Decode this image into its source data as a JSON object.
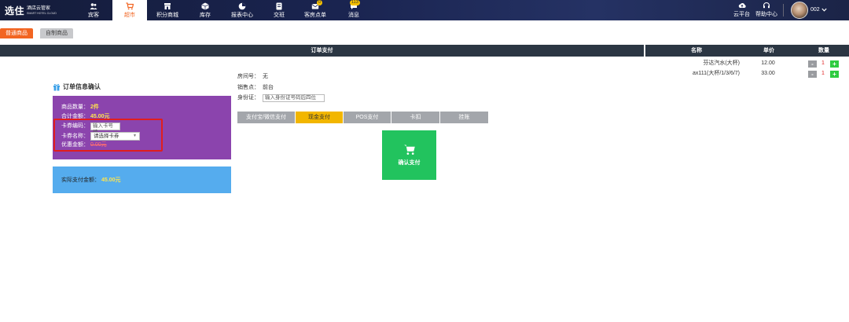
{
  "brand": {
    "logo_main": "选住",
    "logo_sub": "酒店云管家",
    "logo_tiny": "SMART HOTEL CLOUD"
  },
  "nav": [
    {
      "label": "宾客",
      "icon": "users-icon"
    },
    {
      "label": "超市",
      "icon": "cart-icon",
      "active": true
    },
    {
      "label": "积分商城",
      "icon": "store-icon"
    },
    {
      "label": "库存",
      "icon": "box-icon"
    },
    {
      "label": "报表中心",
      "icon": "pie-chart-icon"
    },
    {
      "label": "交班",
      "icon": "handover-icon"
    },
    {
      "label": "客房点单",
      "icon": "order-icon",
      "badge": "0"
    },
    {
      "label": "消息",
      "icon": "message-icon",
      "badge": "113"
    }
  ],
  "top_right": {
    "cloud": "云平台",
    "help": "帮助中心",
    "user": "002"
  },
  "subtabs": {
    "normal": "普通商品",
    "custom": "自制商品"
  },
  "order_header": "订单支付",
  "product_table": {
    "headers": [
      "名称",
      "单价",
      "数量"
    ],
    "rows": [
      {
        "name": "芬达汽水(大杯)",
        "price": "12.00",
        "qty": "1"
      },
      {
        "name": "ax111(大杯/1/3/6/7)",
        "price": "33.00",
        "qty": "1"
      }
    ]
  },
  "order_confirm": {
    "title": "订单信息确认",
    "count_label": "商品数量：",
    "count_value": "2件",
    "total_label": "合计金额：",
    "total_value": "45.00元",
    "card_code_label": "卡券编码：",
    "card_code_placeholder": "输入卡号编",
    "card_name_label": "卡券名称：",
    "card_name_value": "请选择卡券",
    "discount_label": "优惠金额：",
    "discount_value": "0.00元",
    "actual_label": "实际支付金额：",
    "actual_value": "45.00元"
  },
  "info": {
    "room_label": "房间号：",
    "room_value": "无",
    "sale_label": "销售点：",
    "sale_value": "前台",
    "id_label": "身份证：",
    "id_placeholder": "输入身份证号码后四位"
  },
  "payment_tabs": [
    "支付宝/微信支付",
    "现金支付",
    "POS支付",
    "卡扣",
    "挂账"
  ],
  "active_payment": "现金支付",
  "confirm_label": "确认支付",
  "colors": {
    "accent": "#f26522",
    "purple": "#8b44ad",
    "blue": "#55acee",
    "green": "#22c35e",
    "pay_active": "#f2b600",
    "header_dark": "#2b3643"
  }
}
